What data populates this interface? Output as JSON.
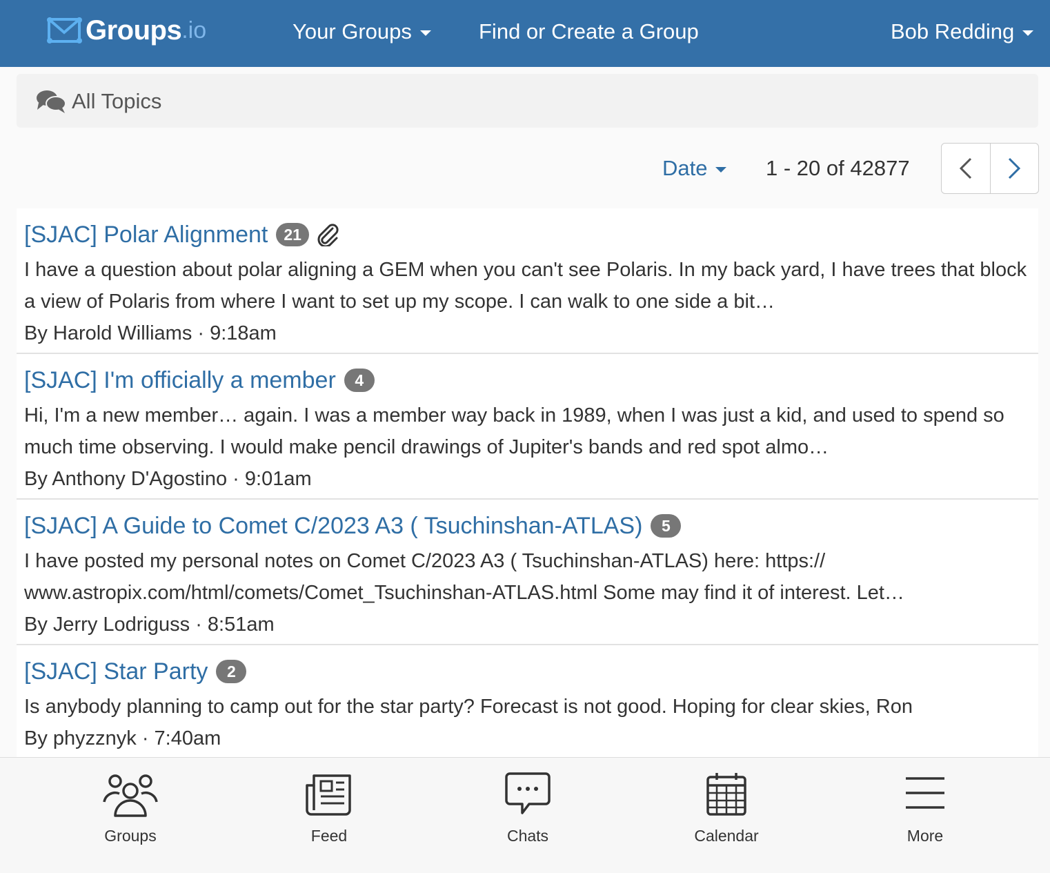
{
  "nav": {
    "logo_text": "Groups",
    "logo_suffix": ".io",
    "your_groups": "Your Groups",
    "find_create": "Find or Create a Group",
    "user_name": "Bob Redding"
  },
  "topics_header": {
    "title": "All Topics",
    "icon": "comments-icon"
  },
  "toolbar": {
    "sort_label": "Date",
    "range_text": "1 - 20 of 42877",
    "prev_icon": "chevron-left-icon",
    "next_icon": "chevron-right-icon"
  },
  "topics": [
    {
      "title": "[SJAC] Polar Alignment",
      "count": "21",
      "has_attachment": true,
      "snippet": "I have a question about polar aligning a GEM when you can't see Polaris. In my back yard, I have trees that block a view of Polaris from where I want to set up my scope. I can walk to one side a bit…",
      "byline": "By Harold Williams · 9:18am"
    },
    {
      "title": "[SJAC] I'm officially a member",
      "count": "4",
      "has_attachment": false,
      "snippet": "Hi, I'm a new member… again. I was a member way back in 1989, when I was just a kid, and used to spend so much time observing. I would make pencil drawings of Jupiter's bands and red spot almo…",
      "byline": "By Anthony D'Agostino · 9:01am"
    },
    {
      "title": "[SJAC] A Guide to Comet C/2023 A3 ( Tsuchinshan-ATLAS)",
      "count": "5",
      "has_attachment": false,
      "snippet": "I have posted my personal notes on Comet C/2023 A3 ( Tsuchinshan-ATLAS) here: https:// www.astropix.com/html/comets/Comet_Tsuchinshan-ATLAS.html Some may find it of interest. Let…",
      "byline": "By Jerry Lodriguss · 8:51am"
    },
    {
      "title": "[SJAC] Star Party",
      "count": "2",
      "has_attachment": false,
      "snippet": "Is anybody planning to camp out for the star party? Forecast is not good. Hoping for clear skies, Ron",
      "byline": "By phyzznyk · 7:40am"
    }
  ],
  "bottom_nav": {
    "groups": "Groups",
    "feed": "Feed",
    "chats": "Chats",
    "calendar": "Calendar",
    "more": "More"
  },
  "colors": {
    "nav_bg": "#3470a8",
    "link": "#2f6ea5",
    "badge_bg": "#777777"
  }
}
